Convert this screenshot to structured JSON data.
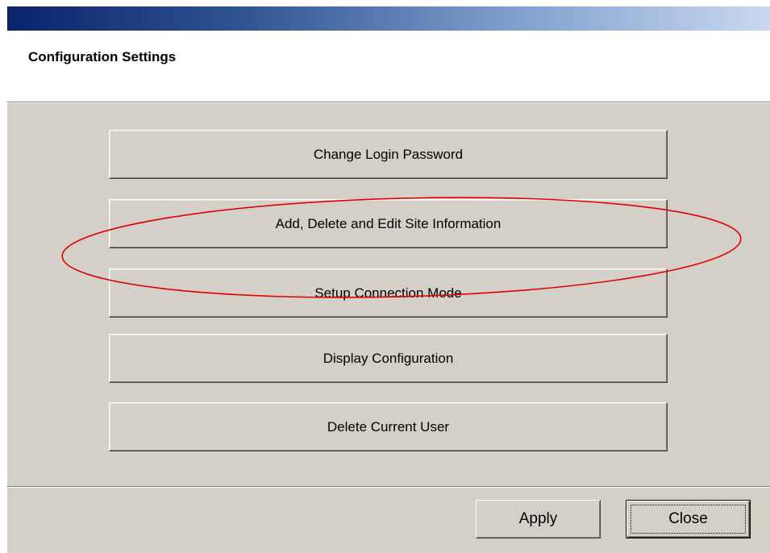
{
  "dialog": {
    "title": "Configuration Settings"
  },
  "actions": [
    {
      "label": "Change Login Password"
    },
    {
      "label": "Add, Delete and Edit Site Information"
    },
    {
      "label": "Setup Connection Mode"
    },
    {
      "label": "Display Configuration"
    },
    {
      "label": "Delete Current User"
    }
  ],
  "footer": {
    "apply_label": "Apply",
    "close_label": "Close"
  },
  "annotation": {
    "shape": "ellipse",
    "color": "#e00000",
    "highlights": "Add, Delete and Edit Site Information"
  },
  "colors": {
    "titlebar_start": "#0a246a",
    "titlebar_end": "#c9d8ee",
    "dialog_face": "#d4d0c8",
    "header_bg": "#ffffff"
  }
}
